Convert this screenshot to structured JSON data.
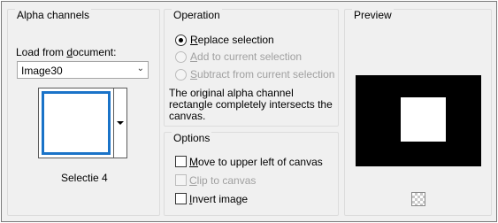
{
  "alpha_channels": {
    "title": "Alpha channels",
    "load_from_label": "Load from document:",
    "document_select": {
      "value": "Image30"
    },
    "channel_name": "Selectie 4"
  },
  "operation": {
    "title": "Operation",
    "options": [
      {
        "label": "Replace selection",
        "checked": true,
        "enabled": true
      },
      {
        "label": "Add to current selection",
        "checked": false,
        "enabled": false
      },
      {
        "label": "Subtract from current selection",
        "checked": false,
        "enabled": false
      }
    ],
    "info_line1": "The original alpha channel",
    "info_line2": "rectangle completely intersects the",
    "info_line3": "canvas."
  },
  "options": {
    "title": "Options",
    "checkboxes": [
      {
        "label": "Move to upper left of canvas",
        "checked": false,
        "enabled": true
      },
      {
        "label": "Clip to canvas",
        "checked": false,
        "enabled": false
      },
      {
        "label": "Invert image",
        "checked": false,
        "enabled": true
      }
    ]
  },
  "preview": {
    "title": "Preview",
    "background_color": "#000000",
    "selection_color": "#ffffff"
  }
}
